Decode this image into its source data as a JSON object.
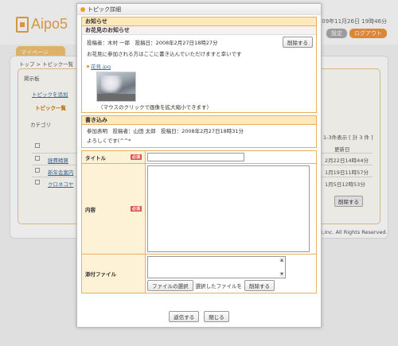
{
  "background": {
    "logo": "Aipo5",
    "datetime": "09年11月26日 19時46分",
    "settings_button": "設定",
    "logout_button": "ログアウト",
    "my_page_tab": "マイページ",
    "breadcrumb": "トップ > トピック一覧",
    "board_tab": "掲示板",
    "add_topic": "トピックを追加",
    "topic_list_header": "トピック一覧",
    "category_label": "カテゴリ",
    "count_text": "1-3件表示 [ 計 3 件 ]",
    "updated_header": "更新日",
    "rows": [
      {
        "title": "経費精算",
        "date": "2月22日14時44分"
      },
      {
        "title": "新年会案内",
        "date": "1月19日11時57分"
      },
      {
        "title": "クロネコヤ",
        "date": "1月5日12時53分"
      }
    ],
    "delete_button": "削除する",
    "footer_text": "k,Inc. All Rights Reserved."
  },
  "modal": {
    "title": "トピック詳細",
    "notice_header": "お知らせ",
    "notice_subject": "お花見のお知らせ",
    "notice_meta": "投稿者：木村 一郎　投稿日：2008年2月27日18時27分",
    "notice_body": "お花見に参加される方はここに書き込んでいただけますと幸いです",
    "attachment_name": "花見.jpg",
    "photo_caption": "（マウスのクリックで画像を拡大縮小できます）",
    "delete_button": "削除する",
    "reply_header": "書き込み",
    "reply_meta": "参加表明　投稿者：山田 太郎　投稿日：2008年2月27日18時31分",
    "reply_body": "よろしくです(^^*",
    "form": {
      "title_label": "タイトル",
      "content_label": "内容",
      "attach_label": "添付ファイル",
      "required_badge": "必須",
      "file_select_button": "ファイルの選択",
      "file_note": "選択したファイルを",
      "file_delete_button": "削除する"
    },
    "submit_button": "返信する",
    "close_button": "閉じる"
  }
}
